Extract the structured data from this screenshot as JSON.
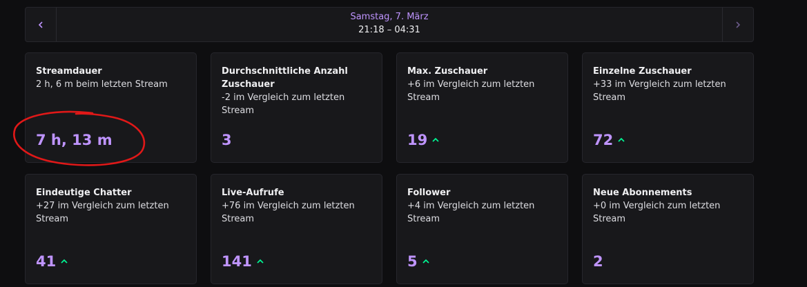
{
  "date_nav": {
    "prev_icon": "chevron-left-icon",
    "day": "Samstag, 7. März",
    "time_range": "21:18 – 04:31",
    "next_icon": "chevron-right-icon"
  },
  "cards": [
    {
      "title": "Streamdauer",
      "sub": "2 h, 6 m beim letzten Stream",
      "value": "7 h, 13 m",
      "trend": "none"
    },
    {
      "title": "Durchschnittliche Anzahl Zuschauer",
      "sub": "-2 im Vergleich zum letzten Stream",
      "value": "3",
      "trend": "none"
    },
    {
      "title": "Max. Zuschauer",
      "sub": "+6 im Vergleich zum letzten Stream",
      "value": "19",
      "trend": "up"
    },
    {
      "title": "Einzelne Zuschauer",
      "sub": "+33 im Vergleich zum letzten Stream",
      "value": "72",
      "trend": "up"
    },
    {
      "title": "Eindeutige Chatter",
      "sub": "+27 im Vergleich zum letzten Stream",
      "value": "41",
      "trend": "up"
    },
    {
      "title": "Live-Aufrufe",
      "sub": "+76 im Vergleich zum letzten Stream",
      "value": "141",
      "trend": "up"
    },
    {
      "title": "Follower",
      "sub": "+4 im Vergleich zum letzten Stream",
      "value": "5",
      "trend": "up"
    },
    {
      "title": "Neue Abonnements",
      "sub": "+0 im Vergleich zum letzten Stream",
      "value": "2",
      "trend": "none"
    }
  ],
  "colors": {
    "accent": "#bf94ff",
    "trend_up": "#00f593",
    "annotation": "#e01818",
    "card_bg": "#18181b",
    "page_bg": "#0e0e10"
  }
}
